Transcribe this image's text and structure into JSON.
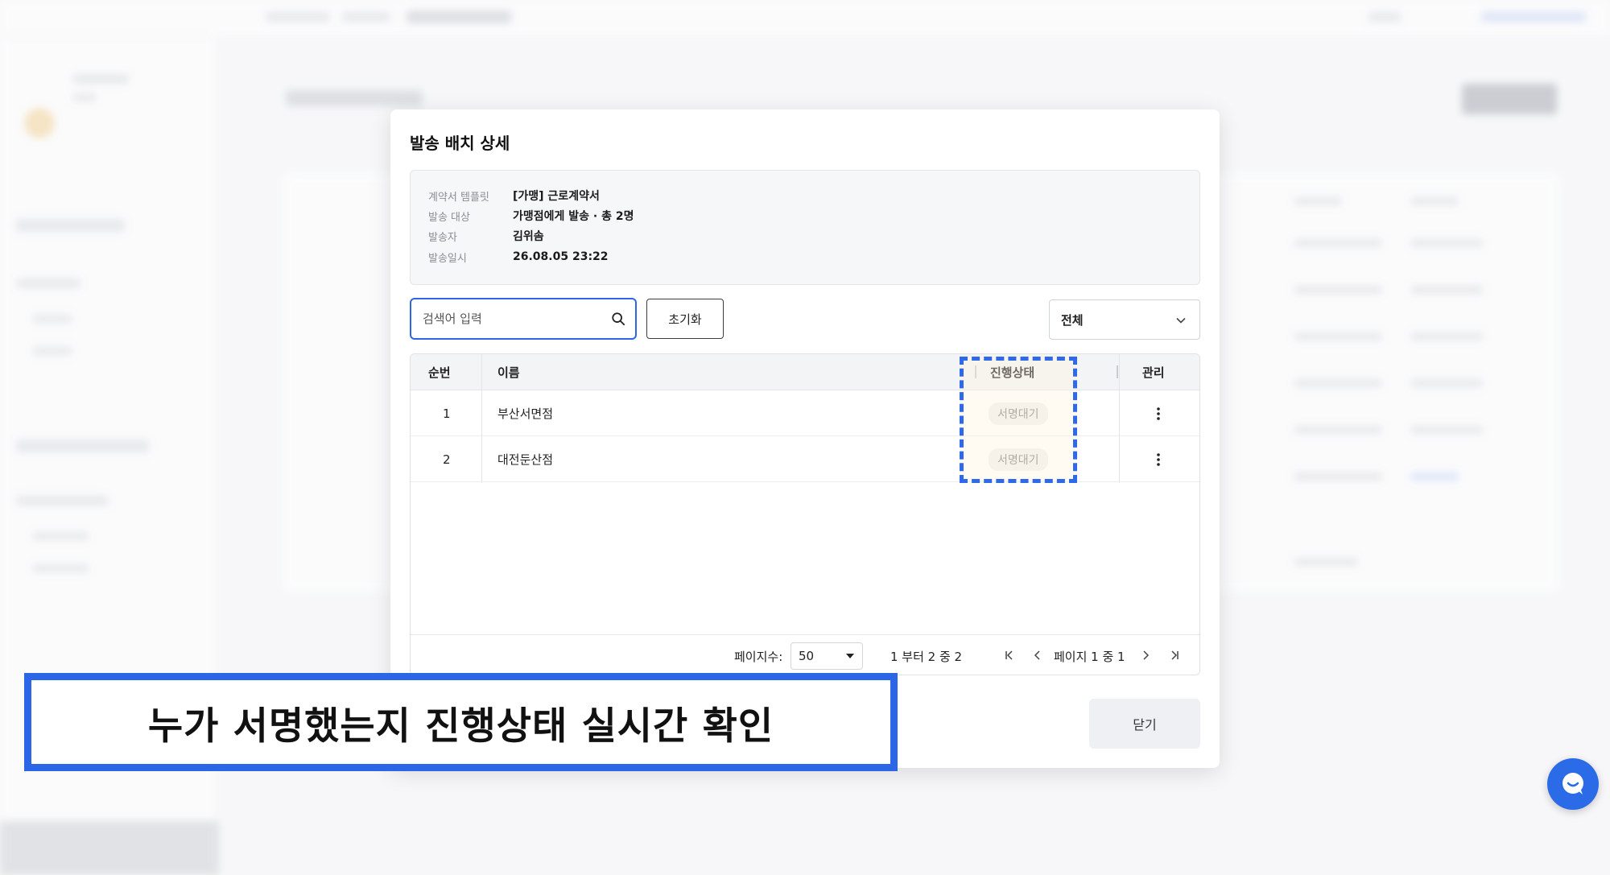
{
  "modal": {
    "title": "발송 배치 상세",
    "info": [
      {
        "key": "계약서 템플릿",
        "value": "[가맹] 근로계약서"
      },
      {
        "key": "발송 대상",
        "value": "가맹점에게 발송 · 총 2명"
      },
      {
        "key": "발송자",
        "value": "김위솜"
      },
      {
        "key": "발송일시",
        "value": "26.08.05 23:22"
      }
    ],
    "search_placeholder": "검색어 입력",
    "reset_label": "초기화",
    "filter_selected": "전체",
    "table": {
      "headers": {
        "index": "순번",
        "name": "이름",
        "status": "진행상태",
        "manage": "관리"
      },
      "rows": [
        {
          "index": "1",
          "name": "부산서면점",
          "status": "서명대기"
        },
        {
          "index": "2",
          "name": "대전둔산점",
          "status": "서명대기"
        }
      ]
    },
    "pager": {
      "page_size_label": "페이지수:",
      "page_size": "50",
      "range": "1 부터 2 중 2",
      "page_info": "페이지 1 중 1"
    },
    "close_label": "닫기"
  },
  "caption": "누가 서명했는지 진행상태 실시간 확인",
  "colors": {
    "accent": "#2b66e6",
    "badge_bg": "#f1f1f1",
    "badge_text": "#888888"
  }
}
